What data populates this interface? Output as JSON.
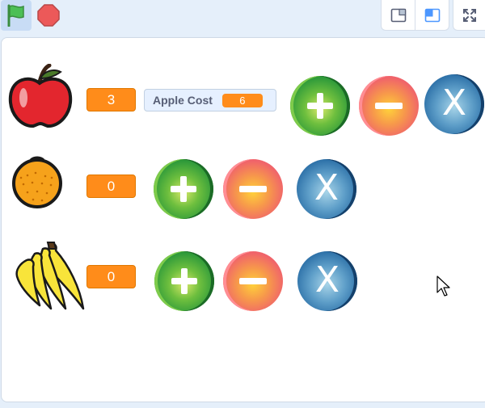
{
  "toolbar": {
    "green_flag_icon": "green-flag-icon",
    "stop_icon": "stop-sign-icon",
    "small_stage_icon": "small-stage-layout-icon",
    "normal_stage_icon": "normal-stage-layout-icon",
    "fullscreen_icon": "fullscreen-icon"
  },
  "stage": {
    "apple": {
      "count": "3",
      "cost_label": "Apple Cost",
      "cost_value": "6"
    },
    "orange": {
      "count": "0"
    },
    "banana": {
      "count": "0"
    },
    "buttons": {
      "x_label": "X"
    }
  },
  "colors": {
    "monitor_orange": "#ff8c1a",
    "toolbar_bg": "#e5effa",
    "stop_red": "#e5474b",
    "flag_green": "#4cbf56"
  }
}
